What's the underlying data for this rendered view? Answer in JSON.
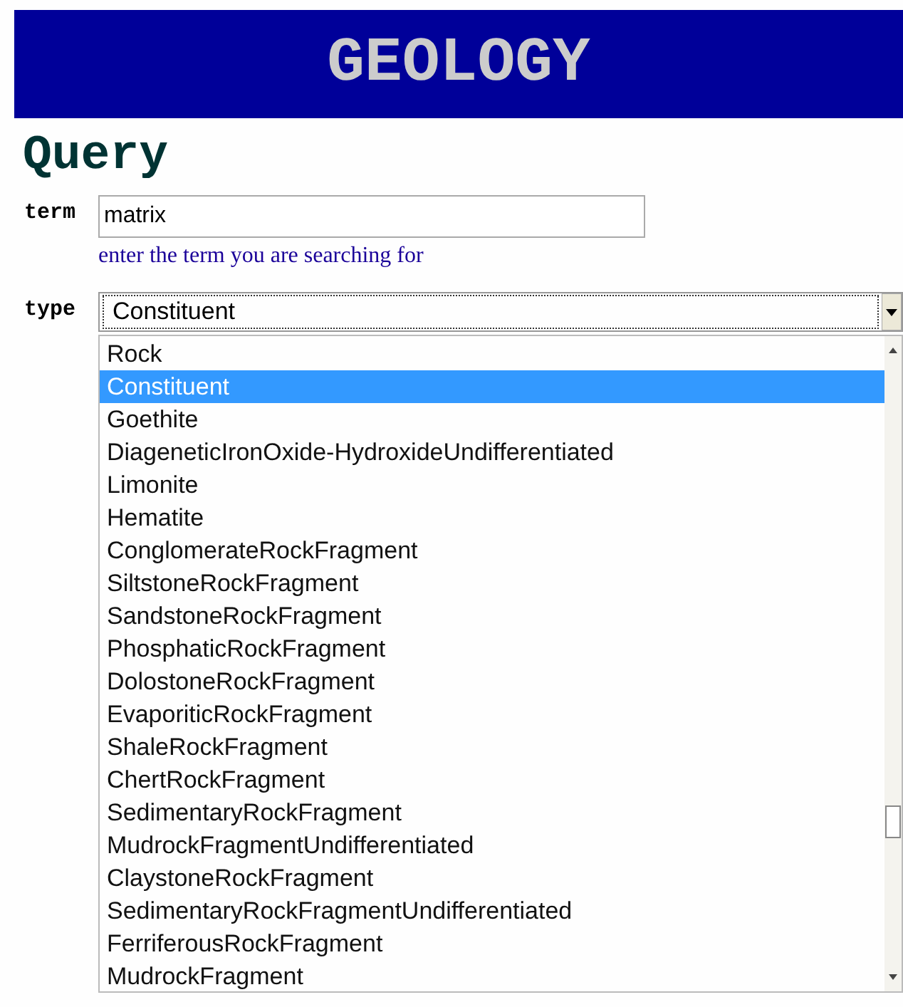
{
  "banner": {
    "title": "GEOLOGY"
  },
  "heading": "Query",
  "term": {
    "label": "term",
    "value": "matrix",
    "hint": "enter the term you are searching for"
  },
  "type": {
    "label": "type",
    "value": "Constituent",
    "options": [
      {
        "label": "Rock",
        "selected": false
      },
      {
        "label": "Constituent",
        "selected": true
      },
      {
        "label": "Goethite",
        "selected": false
      },
      {
        "label": "DiageneticIronOxide-HydroxideUndifferentiated",
        "selected": false
      },
      {
        "label": "Limonite",
        "selected": false
      },
      {
        "label": "Hematite",
        "selected": false
      },
      {
        "label": "ConglomerateRockFragment",
        "selected": false
      },
      {
        "label": "SiltstoneRockFragment",
        "selected": false
      },
      {
        "label": "SandstoneRockFragment",
        "selected": false
      },
      {
        "label": "PhosphaticRockFragment",
        "selected": false
      },
      {
        "label": "DolostoneRockFragment",
        "selected": false
      },
      {
        "label": "EvaporiticRockFragment",
        "selected": false
      },
      {
        "label": "ShaleRockFragment",
        "selected": false
      },
      {
        "label": "ChertRockFragment",
        "selected": false
      },
      {
        "label": "SedimentaryRockFragment",
        "selected": false
      },
      {
        "label": "MudrockFragmentUndifferentiated",
        "selected": false
      },
      {
        "label": "ClaystoneRockFragment",
        "selected": false
      },
      {
        "label": "SedimentaryRockFragmentUndifferentiated",
        "selected": false
      },
      {
        "label": "FerriferousRockFragment",
        "selected": false
      },
      {
        "label": "MudrockFragment",
        "selected": false
      }
    ]
  }
}
